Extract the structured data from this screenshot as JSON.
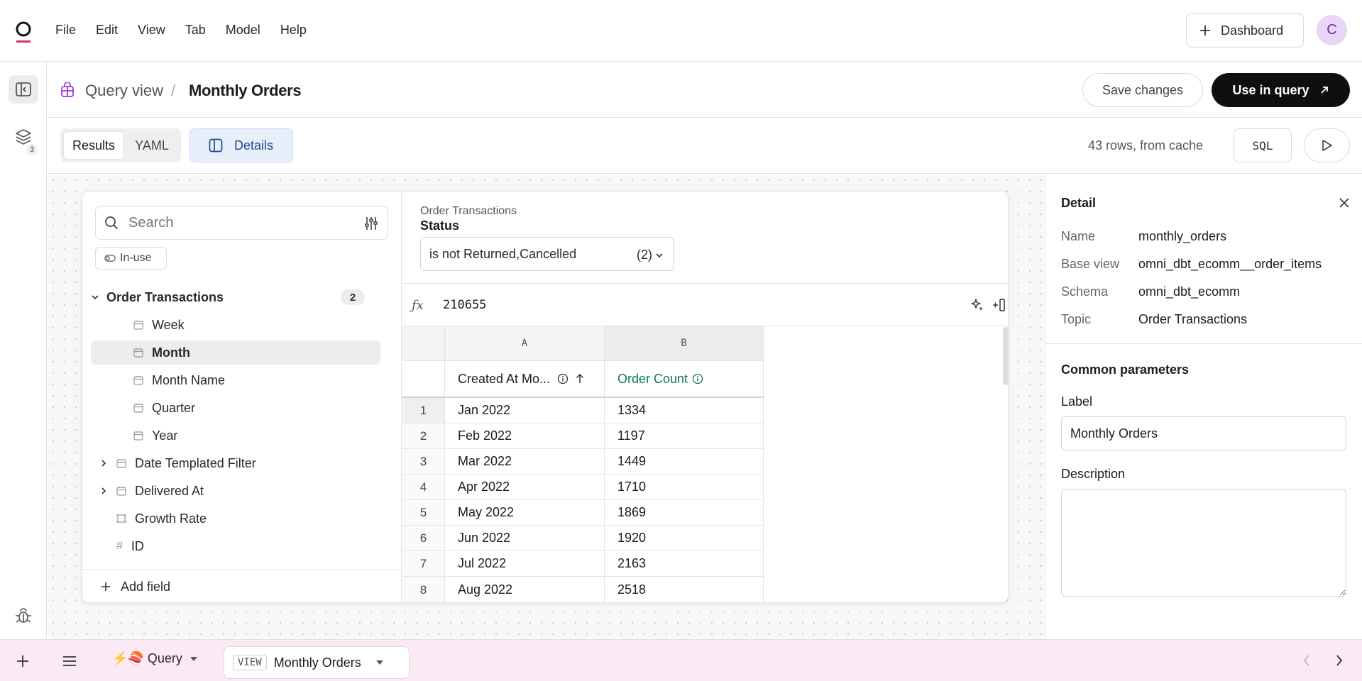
{
  "menu": [
    "File",
    "Edit",
    "View",
    "Tab",
    "Model",
    "Help"
  ],
  "topbar": {
    "dashboard_label": "Dashboard",
    "avatar_initial": "C"
  },
  "rail": {
    "layers_badge": "3"
  },
  "breadcrumb": {
    "parent": "Query view",
    "separator": "/",
    "title": "Monthly Orders"
  },
  "actions": {
    "save_label": "Save changes",
    "use_label": "Use in query"
  },
  "toolbar": {
    "results_tab": "Results",
    "yaml_tab": "YAML",
    "details_label": "Details",
    "rows_info": "43 rows, from cache",
    "sql_label": "SQL"
  },
  "fields": {
    "search_placeholder": "Search",
    "inuse_label": "In-use",
    "group": {
      "label": "Order Transactions",
      "count": "2"
    },
    "items": [
      {
        "label": "Week",
        "icon": "calendar-icon"
      },
      {
        "label": "Month",
        "icon": "calendar-icon"
      },
      {
        "label": "Month Name",
        "icon": "calendar-icon"
      },
      {
        "label": "Quarter",
        "icon": "calendar-icon"
      },
      {
        "label": "Year",
        "icon": "calendar-icon"
      },
      {
        "label": "Date Templated Filter",
        "icon": "calendar-icon"
      },
      {
        "label": "Delivered At",
        "icon": "calendar-icon"
      },
      {
        "label": "Growth Rate",
        "icon": "measure-icon"
      },
      {
        "label": "ID",
        "icon": "hash-icon"
      }
    ],
    "add_field_label": "Add field"
  },
  "filter": {
    "source": "Order Transactions",
    "name": "Status",
    "value": "is not Returned,Cancelled",
    "count": "(2)"
  },
  "formula": {
    "fx": "ƒx",
    "value": "210655"
  },
  "grid": {
    "col_letters": [
      "A",
      "B"
    ],
    "headers": [
      "Created At Mo...",
      "Order Count"
    ],
    "rows": [
      [
        "1",
        "Jan 2022",
        "1334"
      ],
      [
        "2",
        "Feb 2022",
        "1197"
      ],
      [
        "3",
        "Mar 2022",
        "1449"
      ],
      [
        "4",
        "Apr 2022",
        "1710"
      ],
      [
        "5",
        "May 2022",
        "1869"
      ],
      [
        "6",
        "Jun 2022",
        "1920"
      ],
      [
        "7",
        "Jul 2022",
        "2163"
      ],
      [
        "8",
        "Aug 2022",
        "2518"
      ]
    ]
  },
  "detail": {
    "title": "Detail",
    "props": [
      {
        "key": "Name",
        "value": "monthly_orders"
      },
      {
        "key": "Base view",
        "value": "omni_dbt_ecomm__order_items"
      },
      {
        "key": "Schema",
        "value": "omni_dbt_ecomm"
      },
      {
        "key": "Topic",
        "value": "Order Transactions"
      }
    ],
    "common_title": "Common parameters",
    "label_title": "Label",
    "label_value": "Monthly Orders",
    "description_title": "Description",
    "description_value": ""
  },
  "bottom": {
    "query_tab": "⚡🍣 Query",
    "view_tag": "VIEW",
    "view_name": "Monthly Orders"
  },
  "colors": {
    "accent_green": "#0f7a4f",
    "primary_black": "#0f0f12",
    "details_blue": "#1e4b8f",
    "bottom_pink": "#fbeaf4"
  }
}
